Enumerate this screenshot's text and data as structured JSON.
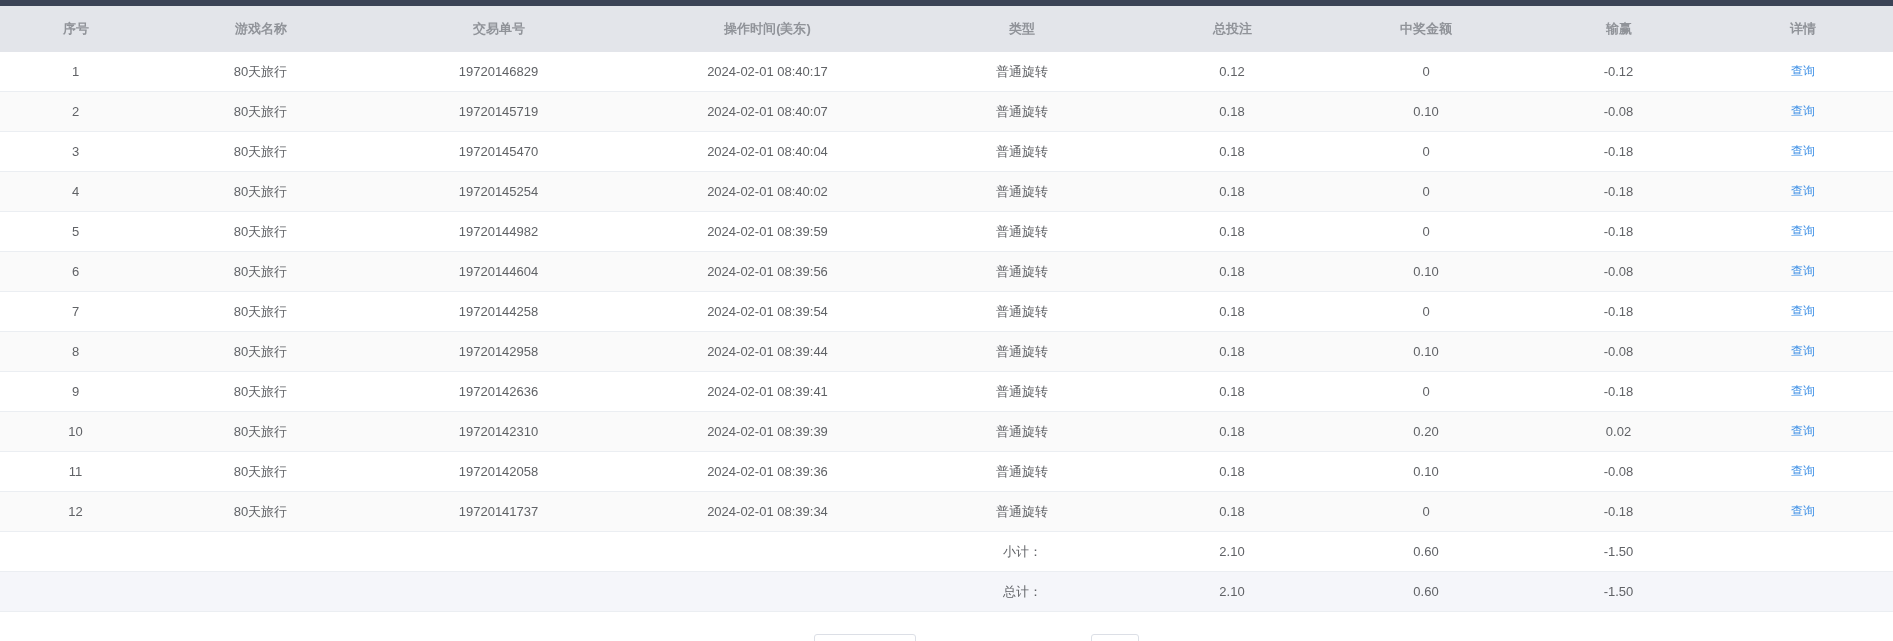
{
  "table": {
    "columns": [
      "序号",
      "游戏名称",
      "交易单号",
      "操作时间(美东)",
      "类型",
      "总投注",
      "中奖金额",
      "输赢",
      "详情"
    ],
    "rows": [
      {
        "cells": [
          "1",
          "80天旅行",
          "19720146829",
          "2024-02-01 08:40:17",
          "普通旋转",
          "0.12",
          "0",
          "-0.12"
        ],
        "link": "查询"
      },
      {
        "cells": [
          "2",
          "80天旅行",
          "19720145719",
          "2024-02-01 08:40:07",
          "普通旋转",
          "0.18",
          "0.10",
          "-0.08"
        ],
        "link": "查询"
      },
      {
        "cells": [
          "3",
          "80天旅行",
          "19720145470",
          "2024-02-01 08:40:04",
          "普通旋转",
          "0.18",
          "0",
          "-0.18"
        ],
        "link": "查询"
      },
      {
        "cells": [
          "4",
          "80天旅行",
          "19720145254",
          "2024-02-01 08:40:02",
          "普通旋转",
          "0.18",
          "0",
          "-0.18"
        ],
        "link": "查询"
      },
      {
        "cells": [
          "5",
          "80天旅行",
          "19720144982",
          "2024-02-01 08:39:59",
          "普通旋转",
          "0.18",
          "0",
          "-0.18"
        ],
        "link": "查询"
      },
      {
        "cells": [
          "6",
          "80天旅行",
          "19720144604",
          "2024-02-01 08:39:56",
          "普通旋转",
          "0.18",
          "0.10",
          "-0.08"
        ],
        "link": "查询"
      },
      {
        "cells": [
          "7",
          "80天旅行",
          "19720144258",
          "2024-02-01 08:39:54",
          "普通旋转",
          "0.18",
          "0",
          "-0.18"
        ],
        "link": "查询"
      },
      {
        "cells": [
          "8",
          "80天旅行",
          "19720142958",
          "2024-02-01 08:39:44",
          "普通旋转",
          "0.18",
          "0.10",
          "-0.08"
        ],
        "link": "查询"
      },
      {
        "cells": [
          "9",
          "80天旅行",
          "19720142636",
          "2024-02-01 08:39:41",
          "普通旋转",
          "0.18",
          "0",
          "-0.18"
        ],
        "link": "查询"
      },
      {
        "cells": [
          "10",
          "80天旅行",
          "19720142310",
          "2024-02-01 08:39:39",
          "普通旋转",
          "0.18",
          "0.20",
          "0.02"
        ],
        "link": "查询"
      },
      {
        "cells": [
          "11",
          "80天旅行",
          "19720142058",
          "2024-02-01 08:39:36",
          "普通旋转",
          "0.18",
          "0.10",
          "-0.08"
        ],
        "link": "查询"
      },
      {
        "cells": [
          "12",
          "80天旅行",
          "19720141737",
          "2024-02-01 08:39:34",
          "普通旋转",
          "0.18",
          "0",
          "-0.18"
        ],
        "link": "查询"
      }
    ],
    "summary": [
      {
        "kind": "subtotal",
        "label": "小计：",
        "total_bet": "2.10",
        "win_amount": "0.60",
        "net": "-1.50"
      },
      {
        "kind": "total",
        "label": "总计：",
        "total_bet": "2.10",
        "win_amount": "0.60",
        "net": "-1.50"
      }
    ]
  }
}
